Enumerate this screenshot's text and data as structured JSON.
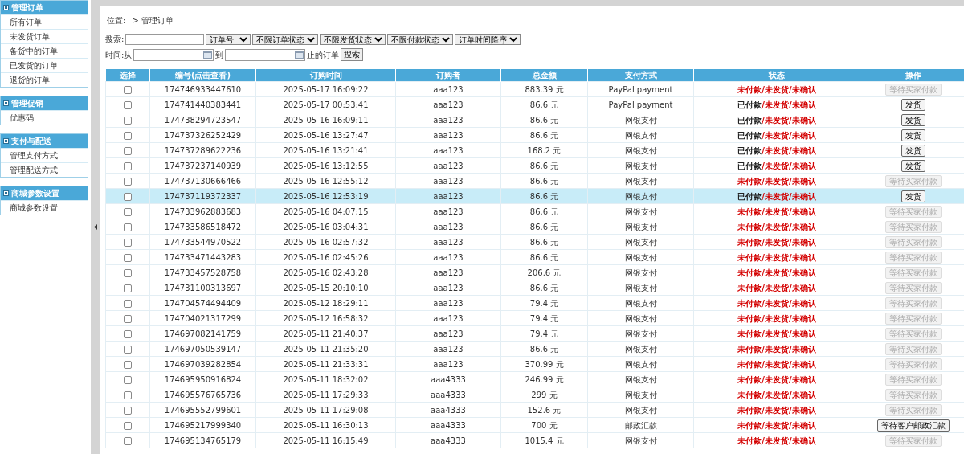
{
  "sidebar": {
    "groups": [
      {
        "title": "管理订单",
        "items": [
          "所有订单",
          "未发货订单",
          "备货中的订单",
          "已发货的订单",
          "退货的订单"
        ]
      },
      {
        "title": "管理促销",
        "items": [
          "优惠码"
        ]
      },
      {
        "title": "支付与配送",
        "items": [
          "管理支付方式",
          "管理配送方式"
        ]
      },
      {
        "title": "商城参数设置",
        "items": [
          "商城参数设置"
        ]
      }
    ]
  },
  "breadcrumb": {
    "label": "位置:",
    "path": "> 管理订单"
  },
  "filters": {
    "search_label": "搜索:",
    "selects": [
      "订单号",
      "不限订单状态",
      "不限发货状态",
      "不限付款状态",
      "订单时间降序"
    ],
    "time_label": "时间:从",
    "to_label": "到",
    "suffix": "止的订单",
    "button": "搜索"
  },
  "table": {
    "columns": [
      "选择",
      "编号(点击查看)",
      "订购时间",
      "订购者",
      "总金额",
      "支付方式",
      "状态",
      "操作"
    ],
    "rows": [
      {
        "selected": false,
        "checked": false,
        "id": "174746933447610",
        "time": "2025-05-17 16:09:22",
        "buyer": "aaa123",
        "amount": "883.39 元",
        "payment": "PayPal payment",
        "status": [
          {
            "text": "未付款",
            "done": false
          },
          {
            "text": "/未发货",
            "done": false
          },
          {
            "text": "/未确认",
            "done": false
          }
        ],
        "action": {
          "label": "等待买家付款",
          "disabled": true
        }
      },
      {
        "selected": false,
        "checked": false,
        "id": "174741440383441",
        "time": "2025-05-17 00:53:41",
        "buyer": "aaa123",
        "amount": "86.6 元",
        "payment": "PayPal payment",
        "status": [
          {
            "text": "已付款",
            "done": true
          },
          {
            "text": "/未发货",
            "done": false
          },
          {
            "text": "/未确认",
            "done": false
          }
        ],
        "action": {
          "label": "发货",
          "disabled": false
        }
      },
      {
        "selected": false,
        "checked": false,
        "id": "174738294723547",
        "time": "2025-05-16 16:09:11",
        "buyer": "aaa123",
        "amount": "86.6 元",
        "payment": "网银支付",
        "status": [
          {
            "text": "已付款",
            "done": true
          },
          {
            "text": "/未发货",
            "done": false
          },
          {
            "text": "/未确认",
            "done": false
          }
        ],
        "action": {
          "label": "发货",
          "disabled": false
        }
      },
      {
        "selected": false,
        "checked": false,
        "id": "174737326252429",
        "time": "2025-05-16 13:27:47",
        "buyer": "aaa123",
        "amount": "86.6 元",
        "payment": "网银支付",
        "status": [
          {
            "text": "已付款",
            "done": true
          },
          {
            "text": "/未发货",
            "done": false
          },
          {
            "text": "/未确认",
            "done": false
          }
        ],
        "action": {
          "label": "发货",
          "disabled": false
        }
      },
      {
        "selected": false,
        "checked": false,
        "id": "174737289622236",
        "time": "2025-05-16 13:21:41",
        "buyer": "aaa123",
        "amount": "168.2 元",
        "payment": "网银支付",
        "status": [
          {
            "text": "已付款",
            "done": true
          },
          {
            "text": "/未发货",
            "done": false
          },
          {
            "text": "/未确认",
            "done": false
          }
        ],
        "action": {
          "label": "发货",
          "disabled": false
        }
      },
      {
        "selected": false,
        "checked": false,
        "id": "174737237140939",
        "time": "2025-05-16 13:12:55",
        "buyer": "aaa123",
        "amount": "86.6 元",
        "payment": "网银支付",
        "status": [
          {
            "text": "已付款",
            "done": true
          },
          {
            "text": "/未发货",
            "done": false
          },
          {
            "text": "/未确认",
            "done": false
          }
        ],
        "action": {
          "label": "发货",
          "disabled": false
        }
      },
      {
        "selected": false,
        "checked": false,
        "id": "174737130666466",
        "time": "2025-05-16 12:55:12",
        "buyer": "aaa123",
        "amount": "86.6 元",
        "payment": "网银支付",
        "status": [
          {
            "text": "未付款",
            "done": false
          },
          {
            "text": "/未发货",
            "done": false
          },
          {
            "text": "/未确认",
            "done": false
          }
        ],
        "action": {
          "label": "等待买家付款",
          "disabled": true
        }
      },
      {
        "selected": true,
        "checked": false,
        "id": "174737119372337",
        "time": "2025-05-16 12:53:19",
        "buyer": "aaa123",
        "amount": "86.6 元",
        "payment": "网银支付",
        "status": [
          {
            "text": "已付款",
            "done": true
          },
          {
            "text": "/未发货",
            "done": false
          },
          {
            "text": "/未确认",
            "done": false
          }
        ],
        "action": {
          "label": "发货",
          "disabled": false
        }
      },
      {
        "selected": false,
        "checked": false,
        "id": "174733962883683",
        "time": "2025-05-16 04:07:15",
        "buyer": "aaa123",
        "amount": "86.6 元",
        "payment": "网银支付",
        "status": [
          {
            "text": "未付款",
            "done": false
          },
          {
            "text": "/未发货",
            "done": false
          },
          {
            "text": "/未确认",
            "done": false
          }
        ],
        "action": {
          "label": "等待买家付款",
          "disabled": true
        }
      },
      {
        "selected": false,
        "checked": false,
        "id": "174733586518472",
        "time": "2025-05-16 03:04:31",
        "buyer": "aaa123",
        "amount": "86.6 元",
        "payment": "网银支付",
        "status": [
          {
            "text": "未付款",
            "done": false
          },
          {
            "text": "/未发货",
            "done": false
          },
          {
            "text": "/未确认",
            "done": false
          }
        ],
        "action": {
          "label": "等待买家付款",
          "disabled": true
        }
      },
      {
        "selected": false,
        "checked": false,
        "id": "174733544970522",
        "time": "2025-05-16 02:57:32",
        "buyer": "aaa123",
        "amount": "86.6 元",
        "payment": "网银支付",
        "status": [
          {
            "text": "未付款",
            "done": false
          },
          {
            "text": "/未发货",
            "done": false
          },
          {
            "text": "/未确认",
            "done": false
          }
        ],
        "action": {
          "label": "等待买家付款",
          "disabled": true
        }
      },
      {
        "selected": false,
        "checked": false,
        "id": "174733471443283",
        "time": "2025-05-16 02:45:26",
        "buyer": "aaa123",
        "amount": "86.6 元",
        "payment": "网银支付",
        "status": [
          {
            "text": "未付款",
            "done": false
          },
          {
            "text": "/未发货",
            "done": false
          },
          {
            "text": "/未确认",
            "done": false
          }
        ],
        "action": {
          "label": "等待买家付款",
          "disabled": true
        }
      },
      {
        "selected": false,
        "checked": false,
        "id": "174733457528758",
        "time": "2025-05-16 02:43:28",
        "buyer": "aaa123",
        "amount": "206.6 元",
        "payment": "网银支付",
        "status": [
          {
            "text": "未付款",
            "done": false
          },
          {
            "text": "/未发货",
            "done": false
          },
          {
            "text": "/未确认",
            "done": false
          }
        ],
        "action": {
          "label": "等待买家付款",
          "disabled": true
        }
      },
      {
        "selected": false,
        "checked": false,
        "id": "174731100313697",
        "time": "2025-05-15 20:10:10",
        "buyer": "aaa123",
        "amount": "86.6 元",
        "payment": "网银支付",
        "status": [
          {
            "text": "未付款",
            "done": false
          },
          {
            "text": "/未发货",
            "done": false
          },
          {
            "text": "/未确认",
            "done": false
          }
        ],
        "action": {
          "label": "等待买家付款",
          "disabled": true
        }
      },
      {
        "selected": false,
        "checked": false,
        "id": "174704574494409",
        "time": "2025-05-12 18:29:11",
        "buyer": "aaa123",
        "amount": "79.4 元",
        "payment": "网银支付",
        "status": [
          {
            "text": "未付款",
            "done": false
          },
          {
            "text": "/未发货",
            "done": false
          },
          {
            "text": "/未确认",
            "done": false
          }
        ],
        "action": {
          "label": "等待买家付款",
          "disabled": true
        }
      },
      {
        "selected": false,
        "checked": false,
        "id": "174704021317299",
        "time": "2025-05-12 16:58:32",
        "buyer": "aaa123",
        "amount": "79.4 元",
        "payment": "网银支付",
        "status": [
          {
            "text": "未付款",
            "done": false
          },
          {
            "text": "/未发货",
            "done": false
          },
          {
            "text": "/未确认",
            "done": false
          }
        ],
        "action": {
          "label": "等待买家付款",
          "disabled": true
        }
      },
      {
        "selected": false,
        "checked": false,
        "id": "174697082141759",
        "time": "2025-05-11 21:40:37",
        "buyer": "aaa123",
        "amount": "79.4 元",
        "payment": "网银支付",
        "status": [
          {
            "text": "未付款",
            "done": false
          },
          {
            "text": "/未发货",
            "done": false
          },
          {
            "text": "/未确认",
            "done": false
          }
        ],
        "action": {
          "label": "等待买家付款",
          "disabled": true
        }
      },
      {
        "selected": false,
        "checked": false,
        "id": "174697050539147",
        "time": "2025-05-11 21:35:20",
        "buyer": "aaa123",
        "amount": "86.6 元",
        "payment": "网银支付",
        "status": [
          {
            "text": "未付款",
            "done": false
          },
          {
            "text": "/未发货",
            "done": false
          },
          {
            "text": "/未确认",
            "done": false
          }
        ],
        "action": {
          "label": "等待买家付款",
          "disabled": true
        }
      },
      {
        "selected": false,
        "checked": false,
        "id": "174697039282854",
        "time": "2025-05-11 21:33:31",
        "buyer": "aaa123",
        "amount": "370.99 元",
        "payment": "网银支付",
        "status": [
          {
            "text": "未付款",
            "done": false
          },
          {
            "text": "/未发货",
            "done": false
          },
          {
            "text": "/未确认",
            "done": false
          }
        ],
        "action": {
          "label": "等待买家付款",
          "disabled": true
        }
      },
      {
        "selected": false,
        "checked": false,
        "id": "174695950916824",
        "time": "2025-05-11 18:32:02",
        "buyer": "aaa4333",
        "amount": "246.99 元",
        "payment": "网银支付",
        "status": [
          {
            "text": "未付款",
            "done": false
          },
          {
            "text": "/未发货",
            "done": false
          },
          {
            "text": "/未确认",
            "done": false
          }
        ],
        "action": {
          "label": "等待买家付款",
          "disabled": true
        }
      },
      {
        "selected": false,
        "checked": false,
        "id": "174695576765736",
        "time": "2025-05-11 17:29:33",
        "buyer": "aaa4333",
        "amount": "299 元",
        "payment": "网银支付",
        "status": [
          {
            "text": "未付款",
            "done": false
          },
          {
            "text": "/未发货",
            "done": false
          },
          {
            "text": "/未确认",
            "done": false
          }
        ],
        "action": {
          "label": "等待买家付款",
          "disabled": true
        }
      },
      {
        "selected": false,
        "checked": false,
        "id": "174695552799601",
        "time": "2025-05-11 17:29:08",
        "buyer": "aaa4333",
        "amount": "152.6 元",
        "payment": "网银支付",
        "status": [
          {
            "text": "未付款",
            "done": false
          },
          {
            "text": "/未发货",
            "done": false
          },
          {
            "text": "/未确认",
            "done": false
          }
        ],
        "action": {
          "label": "等待买家付款",
          "disabled": true
        }
      },
      {
        "selected": false,
        "checked": false,
        "id": "174695217999340",
        "time": "2025-05-11 16:30:13",
        "buyer": "aaa4333",
        "amount": "700 元",
        "payment": "邮政汇款",
        "status": [
          {
            "text": "未付款",
            "done": false
          },
          {
            "text": "/未发货",
            "done": false
          },
          {
            "text": "/未确认",
            "done": false
          }
        ],
        "action": {
          "label": "等待客户邮政汇款",
          "disabled": false
        }
      },
      {
        "selected": false,
        "checked": false,
        "id": "174695134765179",
        "time": "2025-05-11 16:15:49",
        "buyer": "aaa4333",
        "amount": "1015.4 元",
        "payment": "网银支付",
        "status": [
          {
            "text": "未付款",
            "done": false
          },
          {
            "text": "/未发货",
            "done": false
          },
          {
            "text": "/未确认",
            "done": false
          }
        ],
        "action": {
          "label": "等待买家付款",
          "disabled": true
        }
      }
    ]
  }
}
